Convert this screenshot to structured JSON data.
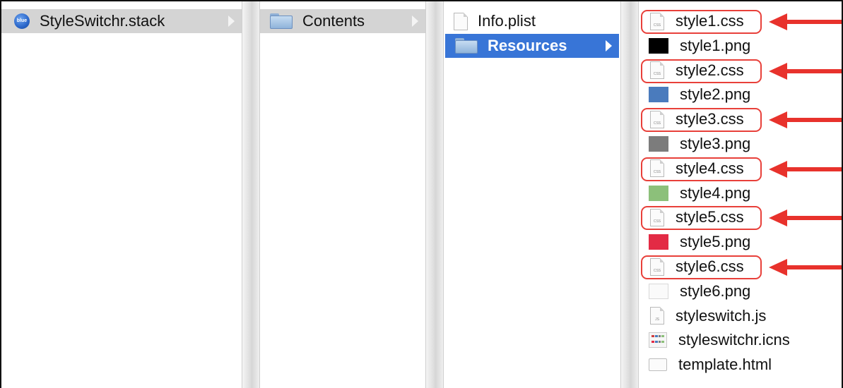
{
  "columns": {
    "col1": {
      "items": [
        {
          "label": "StyleSwitchr.stack",
          "icon": "app-icon",
          "icon_text": "blue"
        }
      ]
    },
    "col2": {
      "items": [
        {
          "label": "Contents",
          "icon": "folder-icon"
        }
      ]
    },
    "col3": {
      "items": [
        {
          "label": "Info.plist",
          "icon": "document-icon"
        },
        {
          "label": "Resources",
          "icon": "folder-icon"
        }
      ]
    },
    "col4": {
      "items": [
        {
          "label": "style1.css",
          "icon": "css-file-icon",
          "icon_text": "CSS",
          "highlighted": true
        },
        {
          "label": "style1.png",
          "icon": "image-swatch-icon",
          "swatch_color": "#000000"
        },
        {
          "label": "style2.css",
          "icon": "css-file-icon",
          "icon_text": "CSS",
          "highlighted": true
        },
        {
          "label": "style2.png",
          "icon": "image-swatch-icon",
          "swatch_color": "#4a7bbd"
        },
        {
          "label": "style3.css",
          "icon": "css-file-icon",
          "icon_text": "CSS",
          "highlighted": true
        },
        {
          "label": "style3.png",
          "icon": "image-swatch-icon",
          "swatch_color": "#7c7c7c"
        },
        {
          "label": "style4.css",
          "icon": "css-file-icon",
          "icon_text": "CSS",
          "highlighted": true
        },
        {
          "label": "style4.png",
          "icon": "image-swatch-icon",
          "swatch_color": "#8cc07a"
        },
        {
          "label": "style5.css",
          "icon": "css-file-icon",
          "icon_text": "CSS",
          "highlighted": true
        },
        {
          "label": "style5.png",
          "icon": "image-swatch-icon",
          "swatch_color": "#e32b45"
        },
        {
          "label": "style6.css",
          "icon": "css-file-icon",
          "icon_text": "CSS",
          "highlighted": true
        },
        {
          "label": "style6.png",
          "icon": "image-swatch-icon",
          "swatch_color": "#fafafa"
        },
        {
          "label": "styleswitch.js",
          "icon": "js-file-icon",
          "icon_text": "JS"
        },
        {
          "label": "styleswitchr.icns",
          "icon": "icns-file-icon"
        },
        {
          "label": "template.html",
          "icon": "html-file-icon"
        }
      ]
    }
  },
  "colors": {
    "selection_blue": "#3875d7",
    "selection_gray": "#d4d4d4",
    "annotation_red": "#e8322c"
  }
}
